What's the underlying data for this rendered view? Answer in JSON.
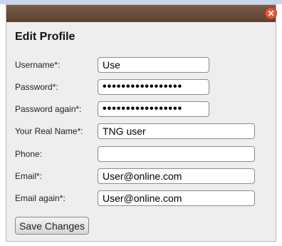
{
  "dialog": {
    "title": "Edit Profile",
    "close_icon": "close-icon"
  },
  "fields": {
    "username": {
      "label": "Username*:",
      "value": "Use"
    },
    "password": {
      "label": "Password*:",
      "value": "•••••••••••••••••"
    },
    "password_again": {
      "label": "Password again*:",
      "value": "•••••••••••••••••"
    },
    "real_name": {
      "label": "Your Real Name*:",
      "value": "TNG user"
    },
    "phone": {
      "label": "Phone:",
      "value": ""
    },
    "email": {
      "label": "Email*:",
      "value": "User@online.com"
    },
    "email_again": {
      "label": "Email again*:",
      "value": "User@online.com"
    }
  },
  "save_button": {
    "label": "Save Changes"
  },
  "colors": {
    "titlebar": "#6b4e3c",
    "close": "#e8553b",
    "dialog_bg": "#eeeeee"
  }
}
